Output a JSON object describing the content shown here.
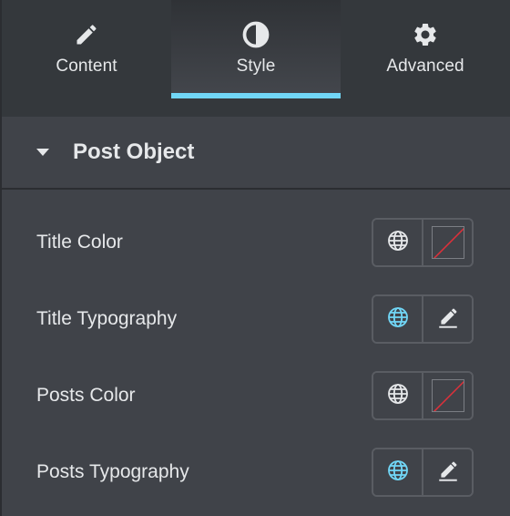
{
  "tabs": [
    {
      "label": "Content",
      "icon": "pencil-icon",
      "active": false
    },
    {
      "label": "Style",
      "icon": "half-circle-icon",
      "active": true
    },
    {
      "label": "Advanced",
      "icon": "gear-icon",
      "active": false
    }
  ],
  "section": {
    "title": "Post Object",
    "expanded": true
  },
  "controls": [
    {
      "label": "Title Color",
      "global_icon": "globe-icon",
      "global_active": false,
      "picker_icon": "no-color-swatch-icon"
    },
    {
      "label": "Title Typography",
      "global_icon": "globe-icon",
      "global_active": true,
      "picker_icon": "edit-pencil-icon"
    },
    {
      "label": "Posts Color",
      "global_icon": "globe-icon",
      "global_active": false,
      "picker_icon": "no-color-swatch-icon"
    },
    {
      "label": "Posts Typography",
      "global_icon": "globe-icon",
      "global_active": true,
      "picker_icon": "edit-pencil-icon"
    }
  ],
  "colors": {
    "accent": "#71d7f7",
    "text": "#e6e8ea",
    "panel_bg": "#404349",
    "tabs_bg": "#34383c",
    "global_active": "#71d7f7",
    "swatch_slash": "#e0303a"
  }
}
